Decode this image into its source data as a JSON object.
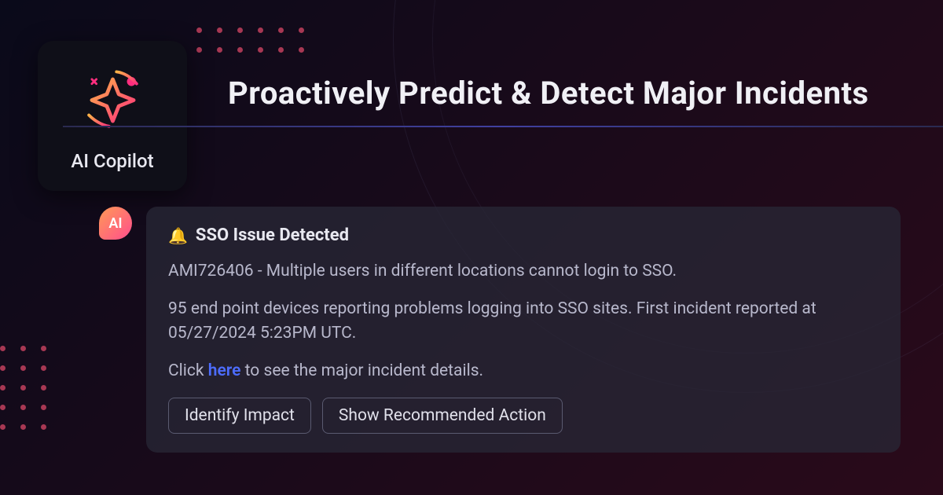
{
  "copilot": {
    "label": "AI Copilot"
  },
  "headline": "Proactively Predict & Detect Major Incidents",
  "avatar": {
    "initials": "AI"
  },
  "message": {
    "bell": "🔔",
    "title": "SSO Issue Detected",
    "line1": "AMI726406 - Multiple users in different locations cannot login to SSO.",
    "line2": "95 end point devices reporting problems logging into SSO sites. First incident reported at 05/27/2024 5:23PM UTC.",
    "cta_prefix": "Click ",
    "cta_link": "here",
    "cta_suffix": " to see the major incident details."
  },
  "actions": {
    "identify": "Identify Impact",
    "recommend": "Show Recommended Action"
  }
}
